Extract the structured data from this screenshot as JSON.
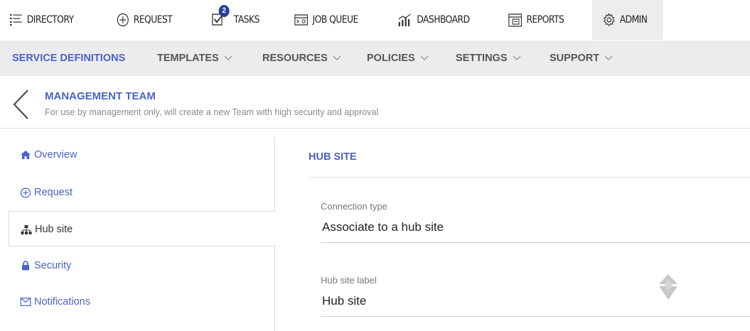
{
  "topnav": {
    "items": [
      {
        "label": "DIRECTORY",
        "icon": "directory-icon"
      },
      {
        "label": "REQUEST",
        "icon": "plus-circle-icon"
      },
      {
        "label": "TASKS",
        "icon": "tasks-icon",
        "badge": "2"
      },
      {
        "label": "JOB QUEUE",
        "icon": "job-queue-icon"
      },
      {
        "label": "DASHBOARD",
        "icon": "dashboard-icon"
      },
      {
        "label": "REPORTS",
        "icon": "reports-icon"
      },
      {
        "label": "ADMIN",
        "icon": "gear-icon",
        "active": true
      }
    ]
  },
  "subnav": {
    "items": [
      {
        "label": "SERVICE DEFINITIONS",
        "active": true
      },
      {
        "label": "TEMPLATES",
        "dropdown": true
      },
      {
        "label": "RESOURCES",
        "dropdown": true
      },
      {
        "label": "POLICIES",
        "dropdown": true
      },
      {
        "label": "SETTINGS",
        "dropdown": true
      },
      {
        "label": "SUPPORT",
        "dropdown": true
      }
    ]
  },
  "header": {
    "title": "MANAGEMENT TEAM",
    "subtitle": "For use by management only, will create a new Team with high security and approval"
  },
  "sidemenu": {
    "items": [
      {
        "label": "Overview",
        "icon": "home-icon"
      },
      {
        "label": "Request",
        "icon": "plus-circle-icon"
      },
      {
        "label": "Hub site",
        "icon": "sitemap-icon",
        "active": true
      },
      {
        "label": "Security",
        "icon": "lock-icon"
      },
      {
        "label": "Notifications",
        "icon": "envelope-icon"
      }
    ]
  },
  "content": {
    "section_title": "HUB SITE",
    "fields": [
      {
        "label": "Connection type",
        "value": "Associate to a hub site"
      },
      {
        "label": "Hub site label",
        "value": "Hub site"
      }
    ]
  },
  "colors": {
    "accent": "#4a63c6",
    "badge": "#2c3e9c",
    "subnav_bg": "#ececec",
    "active_top_bg": "#ededed"
  }
}
